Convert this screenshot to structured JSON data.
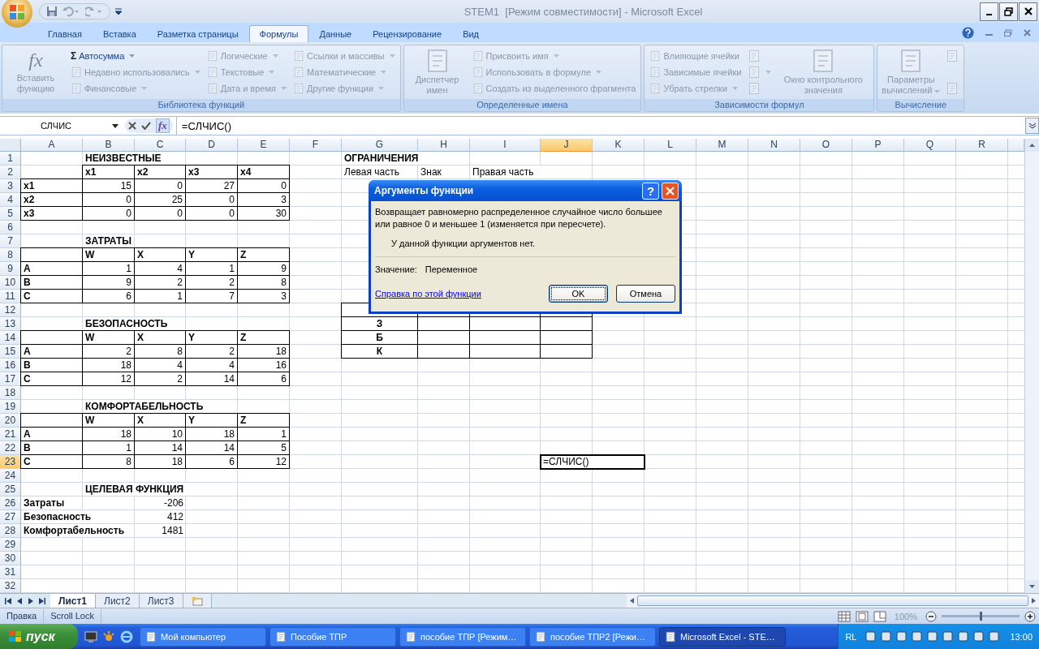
{
  "title_bar": {
    "title": "STEM1  [Режим совместимости] - Microsoft Excel"
  },
  "ribbon_tabs": [
    {
      "label": "Главная",
      "selected": false
    },
    {
      "label": "Вставка",
      "selected": false
    },
    {
      "label": "Разметка страницы",
      "selected": false
    },
    {
      "label": "Формулы",
      "selected": true
    },
    {
      "label": "Данные",
      "selected": false
    },
    {
      "label": "Рецензирование",
      "selected": false
    },
    {
      "label": "Вид",
      "selected": false
    }
  ],
  "ribbon_groups": [
    {
      "title": "Библиотека функций",
      "items": [
        {
          "label": "Вставить функцию",
          "kind": "large",
          "glyph": "fx",
          "dropdown": false,
          "disabled": true
        },
        {
          "label": "Автосумма",
          "kind": "small",
          "glyph": "Σ",
          "dropdown": true,
          "disabled": false
        },
        {
          "label": "Недавно использовались",
          "kind": "small",
          "dropdown": true,
          "disabled": true
        },
        {
          "label": "Финансовые",
          "kind": "small",
          "dropdown": true,
          "disabled": true
        },
        {
          "label": "Логические",
          "kind": "small",
          "dropdown": true,
          "disabled": true
        },
        {
          "label": "Текстовые",
          "kind": "small",
          "dropdown": true,
          "disabled": true
        },
        {
          "label": "Дата и время",
          "kind": "small",
          "dropdown": true,
          "disabled": true
        },
        {
          "label": "Ссылки и массивы",
          "kind": "small",
          "dropdown": true,
          "disabled": true
        },
        {
          "label": "Математические",
          "kind": "small",
          "dropdown": true,
          "disabled": true
        },
        {
          "label": "Другие функции",
          "kind": "small",
          "dropdown": true,
          "disabled": true
        }
      ]
    },
    {
      "title": "Определенные имена",
      "items": [
        {
          "label": "Диспетчер имен",
          "kind": "large",
          "dropdown": false,
          "disabled": true
        },
        {
          "label": "Присвоить имя",
          "kind": "small",
          "dropdown": true,
          "disabled": true
        },
        {
          "label": "Использовать в формуле",
          "kind": "small",
          "dropdown": true,
          "disabled": true
        },
        {
          "label": "Создать из выделенного фрагмента",
          "kind": "small",
          "dropdown": false,
          "disabled": true
        }
      ]
    },
    {
      "title": "Зависимости формул",
      "items": [
        {
          "label": "Влияющие ячейки",
          "kind": "small",
          "dropdown": false,
          "disabled": true
        },
        {
          "label": "Зависимые ячейки",
          "kind": "small",
          "dropdown": false,
          "disabled": true
        },
        {
          "label": "Убрать стрелки",
          "kind": "small",
          "dropdown": true,
          "disabled": true
        },
        {
          "kind": "icon",
          "dropdown": false,
          "disabled": true
        },
        {
          "kind": "icon",
          "dropdown": true,
          "disabled": true
        },
        {
          "kind": "icon",
          "dropdown": false,
          "disabled": true
        },
        {
          "label": "Окно контрольного значения",
          "kind": "large",
          "dropdown": false,
          "disabled": true
        }
      ]
    },
    {
      "title": "Вычисление",
      "items": [
        {
          "label": "Параметры вычислений",
          "kind": "large",
          "dropdown": true,
          "disabled": true
        },
        {
          "kind": "icon",
          "dropdown": false,
          "disabled": true
        },
        {
          "kind": "icon",
          "dropdown": false,
          "disabled": true
        }
      ]
    }
  ],
  "formula_bar": {
    "name_box": "СЛЧИС",
    "fx_button": "fx",
    "formula": "=СЛЧИС()"
  },
  "sheet": {
    "columns": [
      {
        "label": "A",
        "selected": false
      },
      {
        "label": "B",
        "selected": false
      },
      {
        "label": "C",
        "selected": false
      },
      {
        "label": "D",
        "selected": false
      },
      {
        "label": "E",
        "selected": false
      },
      {
        "label": "F",
        "selected": false
      },
      {
        "label": "G",
        "selected": false
      },
      {
        "label": "H",
        "selected": false
      },
      {
        "label": "I",
        "selected": false
      },
      {
        "label": "J",
        "selected": true
      },
      {
        "label": "K",
        "selected": false
      },
      {
        "label": "L",
        "selected": false
      },
      {
        "label": "M",
        "selected": false
      },
      {
        "label": "N",
        "selected": false
      },
      {
        "label": "O",
        "selected": false
      },
      {
        "label": "P",
        "selected": false
      },
      {
        "label": "Q",
        "selected": false
      },
      {
        "label": "R",
        "selected": false
      }
    ],
    "rows": [
      {
        "label": "1",
        "selected": false,
        "cells": {
          "B": {
            "text": "НЕИЗВЕСТНЫЕ",
            "kind": "title",
            "bordered": false
          },
          "G": {
            "text": "ОГРАНИЧЕНИЯ",
            "kind": "title",
            "bordered": false
          }
        }
      },
      {
        "label": "2",
        "selected": false,
        "cells": {
          "B": {
            "text": "x1",
            "kind": "title",
            "bordered": true
          },
          "C": {
            "text": "x2",
            "kind": "title",
            "bordered": true
          },
          "D": {
            "text": "x3",
            "kind": "title",
            "bordered": true
          },
          "E": {
            "text": "x4",
            "kind": "title",
            "bordered": true
          },
          "G": {
            "text": "Левая часть",
            "kind": "label",
            "bordered": false
          },
          "H": {
            "text": "Знак",
            "kind": "label",
            "bordered": false
          },
          "I": {
            "text": "Правая часть",
            "kind": "label",
            "bordered": false
          }
        }
      },
      {
        "label": "3",
        "selected": false,
        "cells": {
          "A": {
            "text": "x1",
            "kind": "title",
            "bordered": true
          },
          "B": {
            "text": "15",
            "kind": "number",
            "bordered": true
          },
          "C": {
            "text": "0",
            "kind": "number",
            "bordered": true
          },
          "D": {
            "text": "27",
            "kind": "number",
            "bordered": true
          },
          "E": {
            "text": "0",
            "kind": "number",
            "bordered": true
          }
        }
      },
      {
        "label": "4",
        "selected": false,
        "cells": {
          "A": {
            "text": "x2",
            "kind": "title",
            "bordered": true
          },
          "B": {
            "text": "0",
            "kind": "number",
            "bordered": true
          },
          "C": {
            "text": "25",
            "kind": "number",
            "bordered": true
          },
          "D": {
            "text": "0",
            "kind": "number",
            "bordered": true
          },
          "E": {
            "text": "3",
            "kind": "number",
            "bordered": true
          }
        }
      },
      {
        "label": "5",
        "selected": false,
        "cells": {
          "A": {
            "text": "x3",
            "kind": "title",
            "bordered": true
          },
          "B": {
            "text": "0",
            "kind": "number",
            "bordered": true
          },
          "C": {
            "text": "0",
            "kind": "number",
            "bordered": true
          },
          "D": {
            "text": "0",
            "kind": "number",
            "bordered": true
          },
          "E": {
            "text": "30",
            "kind": "number",
            "bordered": true
          }
        }
      },
      {
        "label": "6",
        "selected": false
      },
      {
        "label": "7",
        "selected": false,
        "cells": {
          "B": {
            "text": "ЗАТРАТЫ",
            "kind": "title",
            "bordered": false
          }
        }
      },
      {
        "label": "8",
        "selected": false,
        "cells": {
          "A": {
            "kind": "blank",
            "bordered": true
          },
          "B": {
            "text": "W",
            "kind": "title",
            "bordered": true
          },
          "C": {
            "text": "X",
            "kind": "title",
            "bordered": true
          },
          "D": {
            "text": "Y",
            "kind": "title",
            "bordered": true
          },
          "E": {
            "text": "Z",
            "kind": "title",
            "bordered": true
          }
        }
      },
      {
        "label": "9",
        "selected": false,
        "cells": {
          "A": {
            "text": "A",
            "kind": "title",
            "bordered": true
          },
          "B": {
            "text": "1",
            "kind": "number",
            "bordered": true
          },
          "C": {
            "text": "4",
            "kind": "number",
            "bordered": true
          },
          "D": {
            "text": "1",
            "kind": "number",
            "bordered": true
          },
          "E": {
            "text": "9",
            "kind": "number",
            "bordered": true
          }
        }
      },
      {
        "label": "10",
        "selected": false,
        "cells": {
          "A": {
            "text": "B",
            "kind": "title",
            "bordered": true
          },
          "B": {
            "text": "9",
            "kind": "number",
            "bordered": true
          },
          "C": {
            "text": "2",
            "kind": "number",
            "bordered": true
          },
          "D": {
            "text": "2",
            "kind": "number",
            "bordered": true
          },
          "E": {
            "text": "8",
            "kind": "number",
            "bordered": true
          }
        }
      },
      {
        "label": "11",
        "selected": false,
        "cells": {
          "A": {
            "text": "C",
            "kind": "title",
            "bordered": true
          },
          "B": {
            "text": "6",
            "kind": "number",
            "bordered": true
          },
          "C": {
            "text": "1",
            "kind": "number",
            "bordered": true
          },
          "D": {
            "text": "7",
            "kind": "number",
            "bordered": true
          },
          "E": {
            "text": "3",
            "kind": "number",
            "bordered": true
          }
        }
      },
      {
        "label": "12",
        "selected": false,
        "cells": {
          "G": {
            "kind": "blank",
            "bordered": true
          },
          "H": {
            "kind": "blank",
            "bordered": true
          },
          "I": {
            "kind": "blank",
            "bordered": true
          },
          "J": {
            "kind": "blank",
            "bordered": true
          }
        }
      },
      {
        "label": "13",
        "selected": false,
        "cells": {
          "B": {
            "text": "БЕЗОПАСНОСТЬ",
            "kind": "title",
            "bordered": false
          },
          "G": {
            "text": "З",
            "kind": "mark",
            "bordered": true
          },
          "H": {
            "kind": "blank",
            "bordered": true
          },
          "I": {
            "kind": "blank",
            "bordered": true
          },
          "J": {
            "kind": "blank",
            "bordered": true
          }
        }
      },
      {
        "label": "14",
        "selected": false,
        "cells": {
          "A": {
            "kind": "blank",
            "bordered": true
          },
          "B": {
            "text": "W",
            "kind": "title",
            "bordered": true
          },
          "C": {
            "text": "X",
            "kind": "title",
            "bordered": true
          },
          "D": {
            "text": "Y",
            "kind": "title",
            "bordered": true
          },
          "E": {
            "text": "Z",
            "kind": "title",
            "bordered": true
          },
          "G": {
            "text": "Б",
            "kind": "mark",
            "bordered": true
          },
          "H": {
            "kind": "blank",
            "bordered": true
          },
          "I": {
            "kind": "blank",
            "bordered": true
          },
          "J": {
            "kind": "blank",
            "bordered": true
          }
        }
      },
      {
        "label": "15",
        "selected": false,
        "cells": {
          "A": {
            "text": "A",
            "kind": "title",
            "bordered": true
          },
          "B": {
            "text": "2",
            "kind": "number",
            "bordered": true
          },
          "C": {
            "text": "8",
            "kind": "number",
            "bordered": true
          },
          "D": {
            "text": "2",
            "kind": "number",
            "bordered": true
          },
          "E": {
            "text": "18",
            "kind": "number",
            "bordered": true
          },
          "G": {
            "text": "К",
            "kind": "mark",
            "bordered": true
          },
          "H": {
            "kind": "blank",
            "bordered": true
          },
          "I": {
            "kind": "blank",
            "bordered": true
          },
          "J": {
            "kind": "blank",
            "bordered": true
          }
        }
      },
      {
        "label": "16",
        "selected": false,
        "cells": {
          "A": {
            "text": "B",
            "kind": "title",
            "bordered": true
          },
          "B": {
            "text": "18",
            "kind": "number",
            "bordered": true
          },
          "C": {
            "text": "4",
            "kind": "number",
            "bordered": true
          },
          "D": {
            "text": "4",
            "kind": "number",
            "bordered": true
          },
          "E": {
            "text": "16",
            "kind": "number",
            "bordered": true
          }
        }
      },
      {
        "label": "17",
        "selected": false,
        "cells": {
          "A": {
            "text": "C",
            "kind": "title",
            "bordered": true
          },
          "B": {
            "text": "12",
            "kind": "number",
            "bordered": true
          },
          "C": {
            "text": "2",
            "kind": "number",
            "bordered": true
          },
          "D": {
            "text": "14",
            "kind": "number",
            "bordered": true
          },
          "E": {
            "text": "6",
            "kind": "number",
            "bordered": true
          }
        }
      },
      {
        "label": "18",
        "selected": false
      },
      {
        "label": "19",
        "selected": false,
        "cells": {
          "B": {
            "text": "КОМФОРТАБЕЛЬНОСТЬ",
            "kind": "title",
            "bordered": false
          }
        }
      },
      {
        "label": "20",
        "selected": false,
        "cells": {
          "A": {
            "kind": "blank",
            "bordered": true
          },
          "B": {
            "text": "W",
            "kind": "title",
            "bordered": true
          },
          "C": {
            "text": "X",
            "kind": "title",
            "bordered": true
          },
          "D": {
            "text": "Y",
            "kind": "title",
            "bordered": true
          },
          "E": {
            "text": "Z",
            "kind": "title",
            "bordered": true
          }
        }
      },
      {
        "label": "21",
        "selected": false,
        "cells": {
          "A": {
            "text": "A",
            "kind": "title",
            "bordered": true
          },
          "B": {
            "text": "18",
            "kind": "number",
            "bordered": true
          },
          "C": {
            "text": "10",
            "kind": "number",
            "bordered": true
          },
          "D": {
            "text": "18",
            "kind": "number",
            "bordered": true
          },
          "E": {
            "text": "1",
            "kind": "number",
            "bordered": true
          }
        }
      },
      {
        "label": "22",
        "selected": false,
        "cells": {
          "A": {
            "text": "B",
            "kind": "title",
            "bordered": true
          },
          "B": {
            "text": "1",
            "kind": "number",
            "bordered": true
          },
          "C": {
            "text": "14",
            "kind": "number",
            "bordered": true
          },
          "D": {
            "text": "14",
            "kind": "number",
            "bordered": true
          },
          "E": {
            "text": "5",
            "kind": "number",
            "bordered": true
          }
        }
      },
      {
        "label": "23",
        "selected": true,
        "cells": {
          "A": {
            "text": "C",
            "kind": "title",
            "bordered": true
          },
          "B": {
            "text": "8",
            "kind": "number",
            "bordered": true
          },
          "C": {
            "text": "18",
            "kind": "number",
            "bordered": true
          },
          "D": {
            "text": "6",
            "kind": "number",
            "bordered": true
          },
          "E": {
            "text": "12",
            "kind": "number",
            "bordered": true
          },
          "J": {
            "text": "=СЛЧИС()",
            "kind": "label",
            "bordered": false
          }
        }
      },
      {
        "label": "24",
        "selected": false
      },
      {
        "label": "25",
        "selected": false,
        "cells": {
          "B": {
            "text": "ЦЕЛЕВАЯ ФУНКЦИЯ",
            "kind": "title",
            "bordered": false
          }
        }
      },
      {
        "label": "26",
        "selected": false,
        "cells": {
          "A": {
            "text": "Затраты",
            "kind": "title",
            "bordered": false
          },
          "C": {
            "text": "-206",
            "kind": "number",
            "bordered": false
          }
        }
      },
      {
        "label": "27",
        "selected": false,
        "cells": {
          "A": {
            "text": "Безопасность",
            "kind": "title",
            "bordered": false
          },
          "C": {
            "text": "412",
            "kind": "number",
            "bordered": false
          }
        }
      },
      {
        "label": "28",
        "selected": false,
        "cells": {
          "A": {
            "text": "Комфортабельность",
            "kind": "title",
            "bordered": false
          },
          "C": {
            "text": "1481",
            "kind": "number",
            "bordered": false
          }
        }
      },
      {
        "label": "29",
        "selected": false
      },
      {
        "label": "30",
        "selected": false
      },
      {
        "label": "31",
        "selected": false
      },
      {
        "label": "32",
        "selected": false
      }
    ]
  },
  "dialog": {
    "title": "Аргументы функции",
    "help_button": "?",
    "description": "Возвращает равномерно распределенное случайное число большее или равное 0 и меньшее 1 (изменяется при пересчете).",
    "note": "У данной функции аргументов нет.",
    "value_label": "Значение:",
    "value": "Переменное",
    "help_link": "Справка по этой функции",
    "buttons": [
      "OK",
      "Отмена"
    ]
  },
  "sheet_tabs": [
    {
      "label": "Лист1",
      "selected": true
    },
    {
      "label": "Лист2",
      "selected": false
    },
    {
      "label": "Лист3",
      "selected": false
    }
  ],
  "status_bar": {
    "items": [
      "Правка",
      "Scroll Lock"
    ],
    "zoom": "100%",
    "zoom_slider": {
      "level": 0.5
    }
  },
  "taskbar": {
    "start": "пуск",
    "tasks": [
      {
        "label": "Мой компьютер",
        "selected": false
      },
      {
        "label": "Пособие ТПР",
        "selected": false
      },
      {
        "label": "пособие ТПР [Режим…",
        "selected": false
      },
      {
        "label": "пособие ТПР2 [Режи…",
        "selected": false
      },
      {
        "label": "Microsoft Excel - STE…",
        "selected": true
      }
    ],
    "language": "RL",
    "clock": "13:00"
  }
}
